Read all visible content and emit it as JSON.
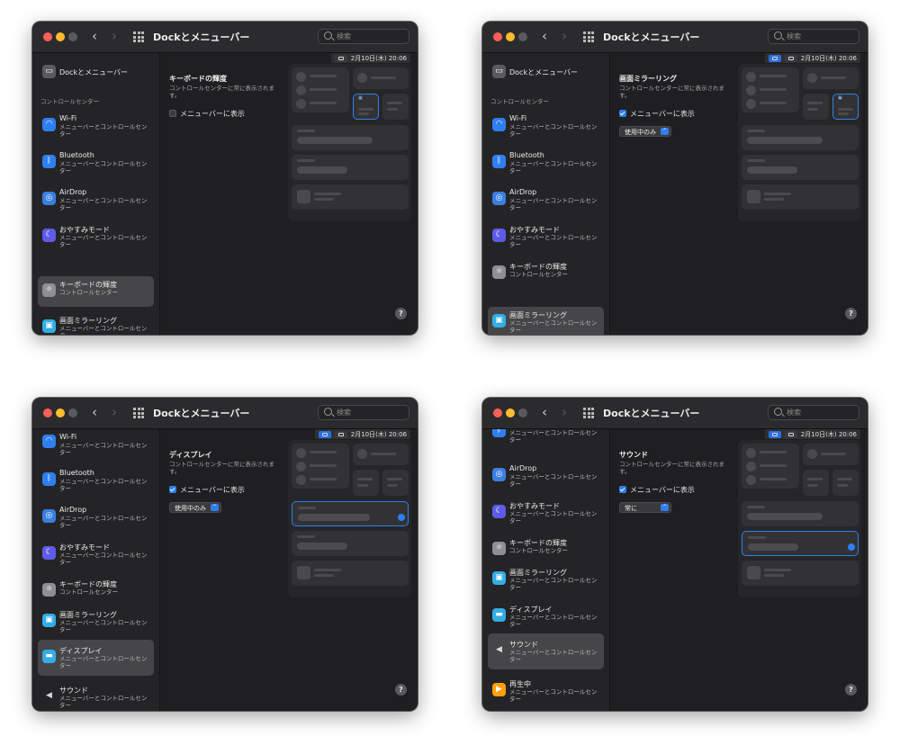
{
  "common": {
    "window_title": "Dockとメニューバー",
    "search_placeholder": "検索",
    "clock": "2月10日(木) 20:06",
    "dock_item": "Dockとメニューバー",
    "section_header": "コントロールセンター",
    "nav_back": "‹",
    "nav_forward": "›",
    "help_label": "?"
  },
  "sidebar_items": {
    "wifi": {
      "title": "Wi-Fi",
      "sub": "メニューバーとコントロールセンター"
    },
    "bluetooth": {
      "title": "Bluetooth",
      "sub": "メニューバーとコントロールセンター"
    },
    "airdrop": {
      "title": "AirDrop",
      "sub": "メニューバーとコントロールセンター"
    },
    "focus": {
      "title": "おやすみモード",
      "sub": "メニューバーとコントロールセンター"
    },
    "keyboard": {
      "title": "キーボードの輝度",
      "sub": "コントロールセンター"
    },
    "mirroring": {
      "title": "画面ミラーリング",
      "sub": "メニューバーとコントロールセンター"
    },
    "display": {
      "title": "ディスプレイ",
      "sub": "メニューバーとコントロールセンター"
    },
    "sound": {
      "title": "サウンド",
      "sub": "メニューバーとコントロールセンター"
    },
    "nowplaying": {
      "title": "再生中",
      "sub": "メニューバーとコントロールセンター"
    }
  },
  "panels": {
    "keyboard": {
      "title": "キーボードの輝度",
      "desc": "コントロールセンターに常に表示されます。",
      "checkbox_label": "メニューバーに表示",
      "checked": false
    },
    "mirroring": {
      "title": "画面ミラーリング",
      "desc": "コントロールセンターに常に表示されます。",
      "checkbox_label": "メニューバーに表示",
      "checked": true,
      "select_value": "使用中のみ"
    },
    "display": {
      "title": "ディスプレイ",
      "desc": "コントロールセンターに常に表示されます。",
      "checkbox_label": "メニューバーに表示",
      "checked": true,
      "select_value": "使用中のみ"
    },
    "sound": {
      "title": "サウンド",
      "desc": "コントロールセンターに常に表示されます。",
      "checkbox_label": "メニューバーに表示",
      "checked": true,
      "select_value": "常に"
    }
  },
  "icons": {
    "wifi": "wifi-icon",
    "bluetooth": "bluetooth-icon",
    "airdrop": "airdrop-icon",
    "focus": "moon-icon",
    "keyboard": "keyboard-brightness-icon",
    "mirroring": "screen-mirroring-icon",
    "display": "display-icon",
    "sound": "speaker-icon",
    "nowplaying": "play-icon"
  },
  "colors": {
    "accent": "#2f7ff0",
    "window_bg": "#1f1f21",
    "selected_row": "#464648",
    "traffic_red": "#fe5f57",
    "traffic_yellow": "#febc2e"
  }
}
